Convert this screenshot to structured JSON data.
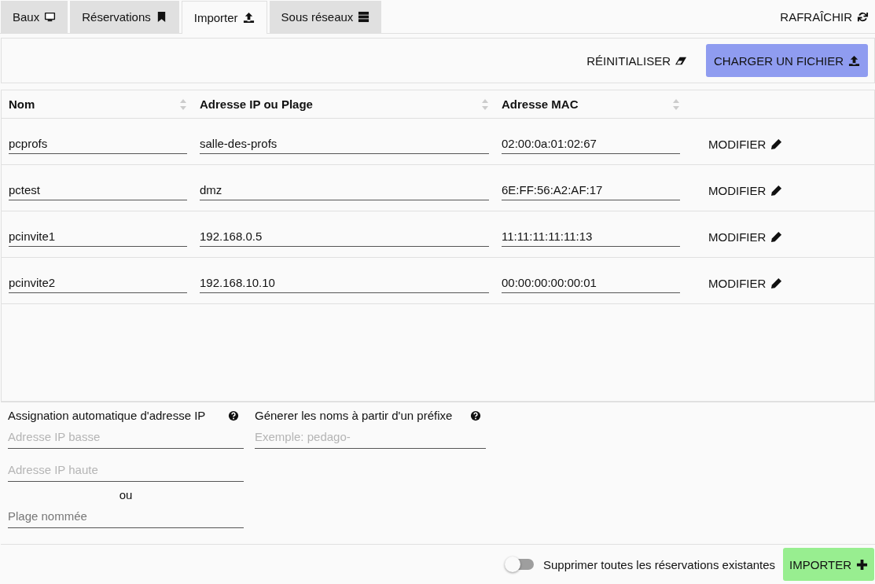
{
  "tabs": [
    {
      "label": "Baux",
      "kind": "monitor",
      "selected": false
    },
    {
      "label": "Réservations",
      "kind": "bookmark",
      "selected": false
    },
    {
      "label": "Importer",
      "kind": "upload",
      "selected": true
    },
    {
      "label": "Sous réseaux",
      "kind": "server",
      "selected": false
    }
  ],
  "refresh_button": "RAFRAÎCHIR",
  "toolbar": {
    "reset_button": "RÉINITIALISER",
    "upload_button": "CHARGER UN FICHIER"
  },
  "table": {
    "columns": [
      "Nom",
      "Adresse IP ou Plage",
      "Adresse MAC"
    ],
    "rows": [
      {
        "name": "pcprofs",
        "ip": "salle-des-profs",
        "mac": "02:00:0a:01:02:67",
        "action": "MODIFIER"
      },
      {
        "name": "pctest",
        "ip": "dmz",
        "mac": "6E:FF:56:A2:AF:17",
        "action": "MODIFIER"
      },
      {
        "name": "pcinvite1",
        "ip": "192.168.0.5",
        "mac": "11:11:11:11:11:13",
        "action": "MODIFIER"
      },
      {
        "name": "pcinvite2",
        "ip": "192.168.10.10",
        "mac": "00:00:00:00:00:01",
        "action": "MODIFIER"
      }
    ]
  },
  "auto_ip": {
    "title": "Assignation automatique d'adresse IP",
    "fields": [
      {
        "kind": "input",
        "placeholder": "Adresse IP basse"
      },
      {
        "kind": "input",
        "placeholder": "Adresse IP haute"
      },
      {
        "kind": "separator",
        "label": "ou"
      },
      {
        "kind": "select",
        "placeholder": "Plage nommée"
      }
    ]
  },
  "prefix": {
    "title": "Génerer les noms à partir d'un préfixe",
    "placeholder": "Exemple: pedago-"
  },
  "footer": {
    "delete_existing": {
      "label": "Supprimer toutes les réservations existantes",
      "on": false
    },
    "import_button": "IMPORTER"
  }
}
